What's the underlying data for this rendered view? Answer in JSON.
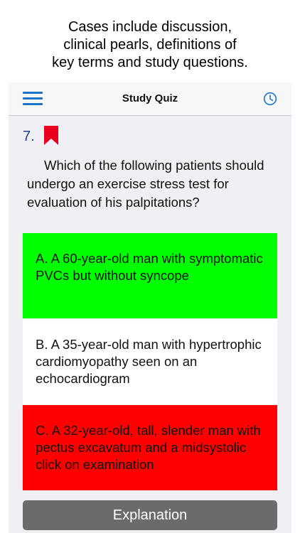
{
  "caption": {
    "line1": "Cases include discussion,",
    "line2": "clinical pearls, definitions of",
    "line3": "key terms and study questions."
  },
  "navbar": {
    "title": "Study Quiz",
    "left_icon": "hamburger-menu-icon",
    "right_icon": "clock-icon",
    "accent_color": "#1a74c9"
  },
  "question": {
    "number": "7.",
    "bookmark_icon": "bookmark-icon",
    "bookmark_color": "#e8001c",
    "text": "Which of the following patients should undergo an exercise stress test for evaluation of his palpitations?"
  },
  "answers": [
    {
      "text": "A. A 60-year-old man with symptomatic PVCs but without syncope",
      "status": "correct",
      "color": "#00ff00"
    },
    {
      "text": "B. A 35-year-old man with hypertrophic cardiomyopathy seen on an echocardiogram",
      "status": "unselected",
      "color": "#ffffff"
    },
    {
      "text": "C. A 32-year-old, tall, slender man with pectus excavatum and a midsystolic click on examination",
      "status": "incorrect",
      "color": "#ff0000"
    }
  ],
  "explanation_button": {
    "label": "Explanation",
    "color": "#6b6b6b"
  }
}
